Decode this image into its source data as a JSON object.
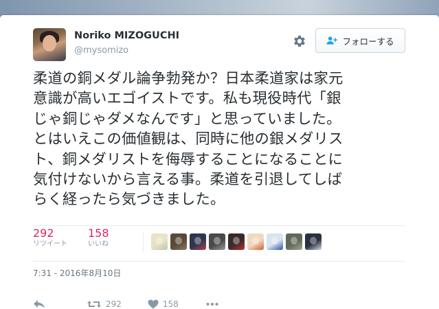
{
  "user": {
    "name": "Noriko MIZOGUCHI",
    "handle": "@mysomizo"
  },
  "follow_button": {
    "label": "フォローする",
    "icon": "add-person-icon"
  },
  "settings": {
    "icon": "gear-icon"
  },
  "tweet": {
    "lines": [
      "柔道の銅メダル論争勃発か？日本柔道家は家元",
      "意識が高いエゴイストです。私も現役時代「銀",
      "じゃ銅じゃダメなんです」と思っていました。",
      "とはいえこの価値観は、同時に他の銀メダリス",
      "ト、銅メダリストを侮辱することになることに",
      "気付けないから言える事。柔道を引退してしば",
      "らく経ったら気づきました。"
    ]
  },
  "stats": {
    "retweets": {
      "count": "292",
      "label": "リツイート"
    },
    "likes": {
      "count": "158",
      "label": "いいね"
    }
  },
  "liker_avatars": [
    {
      "color": "#e8e2c8",
      "accent": "#bfc7a8"
    },
    {
      "color": "#5a4a38",
      "accent": "#8a7a60"
    },
    {
      "color": "#2e3550",
      "accent": "#b04050"
    },
    {
      "color": "#4a4a4a",
      "accent": "#9a9a9a"
    },
    {
      "color": "#3a2a2a",
      "accent": "#c03030"
    },
    {
      "color": "#f0d8c0",
      "accent": "#d06030"
    },
    {
      "color": "#d8e4f0",
      "accent": "#3050a0"
    },
    {
      "color": "#606858",
      "accent": "#a0a890"
    },
    {
      "color": "#2a3040",
      "accent": "#d0d8e8"
    }
  ],
  "timestamp": "7:31 - 2016年8月10日",
  "actions": {
    "reply_icon": "reply-icon",
    "retweet_icon": "retweet-icon",
    "retweet_count": "292",
    "like_icon": "heart-icon",
    "like_count": "158",
    "more_icon": "more-icon"
  },
  "colors": {
    "like_red": "#e0245e",
    "muted": "#8899a6",
    "text": "#292f33"
  }
}
